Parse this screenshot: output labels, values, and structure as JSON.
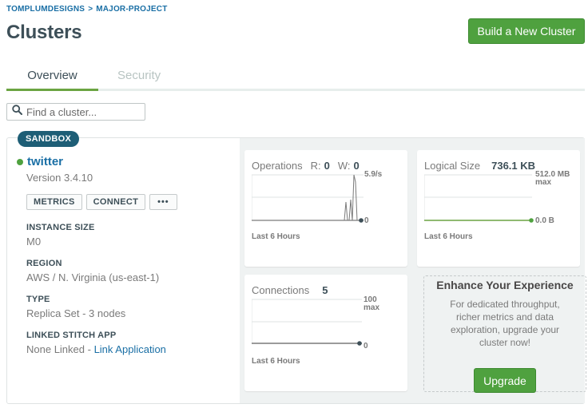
{
  "breadcrumb": {
    "org": "TOMPLUMDESIGNS",
    "sep": ">",
    "project": "MAJOR-PROJECT"
  },
  "page": {
    "title": "Clusters"
  },
  "header": {
    "build_button": "Build a New Cluster"
  },
  "tabs": [
    {
      "label": "Overview",
      "active": true
    },
    {
      "label": "Security",
      "active": false
    }
  ],
  "search": {
    "placeholder": "Find a cluster...",
    "value": ""
  },
  "cluster": {
    "badge": "SANDBOX",
    "name": "twitter",
    "status_color": "#4fa13f",
    "version": "Version 3.4.10",
    "buttons": {
      "metrics": "METRICS",
      "connect": "CONNECT",
      "more": "•••"
    },
    "instance_size_label": "INSTANCE SIZE",
    "instance_size": "M0",
    "region_label": "REGION",
    "region": "AWS / N. Virginia (us-east-1)",
    "type_label": "TYPE",
    "type": "Replica Set - 3 nodes",
    "stitch_label": "LINKED STITCH APP",
    "stitch_value": "None Linked - ",
    "stitch_link": "Link Application"
  },
  "metrics": {
    "operations": {
      "title": "Operations",
      "r_label": "R:",
      "r_value": "0",
      "w_label": "W:",
      "w_value": "0",
      "max": "5.9/s",
      "min": "0",
      "footer": "Last 6 Hours"
    },
    "logical_size": {
      "title": "Logical Size",
      "value": "736.1 KB",
      "max_line1": "512.0 MB",
      "max_line2": "max",
      "min": "0.0 B",
      "footer": "Last 6 Hours"
    },
    "connections": {
      "title": "Connections",
      "value": "5",
      "max_line1": "100",
      "max_line2": "max",
      "min": "0",
      "footer": "Last 6 Hours"
    }
  },
  "enhance": {
    "title": "Enhance Your Experience",
    "description": "For dedicated throughput, richer metrics and data exploration, upgrade your cluster now!",
    "button": "Upgrade"
  },
  "colors": {
    "accent_green": "#4fa13f",
    "link_blue": "#1a6fa5",
    "badge_teal": "#1e5e76"
  },
  "icons": {
    "search": "search-icon",
    "more": "more-icon"
  }
}
